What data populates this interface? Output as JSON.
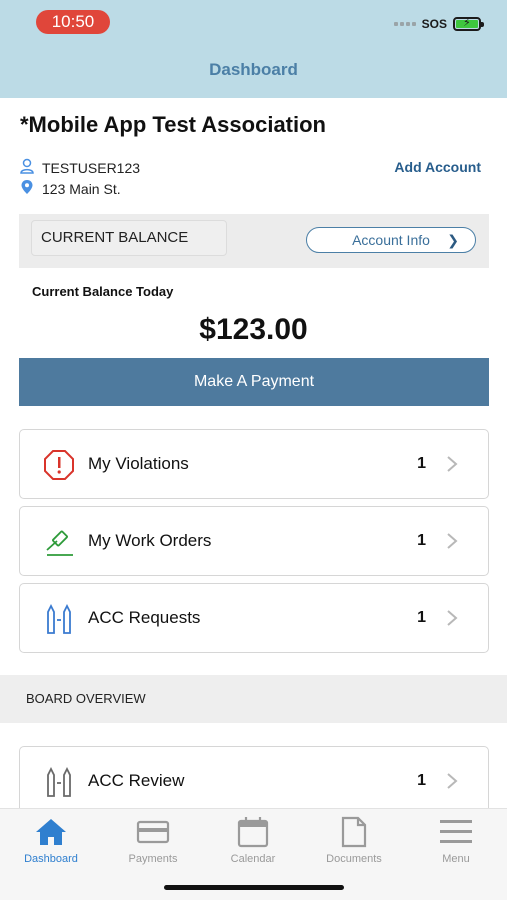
{
  "status_bar": {
    "time": "10:50",
    "carrier": "SOS",
    "battery_level": 1.0,
    "colors": {
      "time_pill": "#e0463a",
      "battery": "#3ec73e"
    }
  },
  "header": {
    "title": "Dashboard",
    "background": "#bcdbe6"
  },
  "association": {
    "name": "*Mobile App Test Association",
    "user": "TESTUSER123",
    "address": "123 Main St.",
    "add_account_label": "Add Account",
    "icons": {
      "user": "user-icon",
      "address": "location-pin-icon"
    }
  },
  "balance": {
    "section_label": "CURRENT BALANCE",
    "account_info_label": "Account Info",
    "caption": "Current Balance Today",
    "amount": "$123.00",
    "pay_button_label": "Make A Payment",
    "pay_button_color": "#4e7a9e"
  },
  "items": [
    {
      "label": "My Violations",
      "count": "1",
      "icon": "violation-alert-icon",
      "icon_color": "#d9342b"
    },
    {
      "label": "My Work Orders",
      "count": "1",
      "icon": "work-order-hammer-icon",
      "icon_color": "#2e9b3a"
    },
    {
      "label": "ACC Requests",
      "count": "1",
      "icon": "acc-request-icon",
      "icon_color": "#3b7bd0"
    }
  ],
  "board": {
    "section_title": "BOARD OVERVIEW",
    "items": [
      {
        "label": "ACC Review",
        "count": "1",
        "icon": "acc-review-icon",
        "icon_color": "#6a6a6a"
      }
    ]
  },
  "tabbar": {
    "tabs": [
      {
        "label": "Dashboard",
        "icon": "home-icon",
        "active": true
      },
      {
        "label": "Payments",
        "icon": "credit-card-icon",
        "active": false
      },
      {
        "label": "Calendar",
        "icon": "calendar-icon",
        "active": false
      },
      {
        "label": "Documents",
        "icon": "document-icon",
        "active": false
      },
      {
        "label": "Menu",
        "icon": "menu-icon",
        "active": false
      }
    ],
    "active_color": "#2f7fcf"
  }
}
